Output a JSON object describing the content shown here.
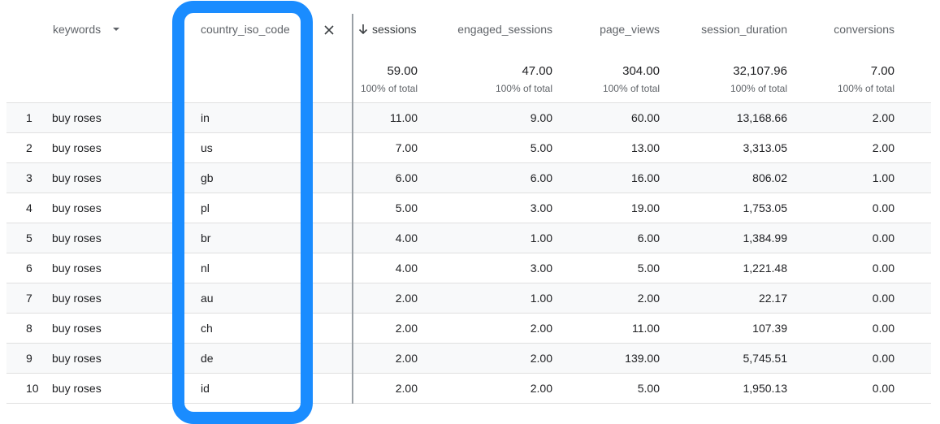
{
  "table": {
    "columns": {
      "keywords": "keywords",
      "country": "country_iso_code",
      "sessions": "sessions",
      "engaged_sessions": "engaged_sessions",
      "page_views": "page_views",
      "session_duration": "session_duration",
      "conversions": "conversions"
    },
    "totals": {
      "sessions": "59.00",
      "engaged_sessions": "47.00",
      "page_views": "304.00",
      "session_duration": "32,107.96",
      "conversions": "7.00"
    },
    "pct_label": "100% of total",
    "rows": [
      {
        "idx": "1",
        "keyword": "buy roses",
        "country": "in",
        "sessions": "11.00",
        "engaged_sessions": "9.00",
        "page_views": "60.00",
        "session_duration": "13,168.66",
        "conversions": "2.00"
      },
      {
        "idx": "2",
        "keyword": "buy roses",
        "country": "us",
        "sessions": "7.00",
        "engaged_sessions": "5.00",
        "page_views": "13.00",
        "session_duration": "3,313.05",
        "conversions": "2.00"
      },
      {
        "idx": "3",
        "keyword": "buy roses",
        "country": "gb",
        "sessions": "6.00",
        "engaged_sessions": "6.00",
        "page_views": "16.00",
        "session_duration": "806.02",
        "conversions": "1.00"
      },
      {
        "idx": "4",
        "keyword": "buy roses",
        "country": "pl",
        "sessions": "5.00",
        "engaged_sessions": "3.00",
        "page_views": "19.00",
        "session_duration": "1,753.05",
        "conversions": "0.00"
      },
      {
        "idx": "5",
        "keyword": "buy roses",
        "country": "br",
        "sessions": "4.00",
        "engaged_sessions": "1.00",
        "page_views": "6.00",
        "session_duration": "1,384.99",
        "conversions": "0.00"
      },
      {
        "idx": "6",
        "keyword": "buy roses",
        "country": "nl",
        "sessions": "4.00",
        "engaged_sessions": "3.00",
        "page_views": "5.00",
        "session_duration": "1,221.48",
        "conversions": "0.00"
      },
      {
        "idx": "7",
        "keyword": "buy roses",
        "country": "au",
        "sessions": "2.00",
        "engaged_sessions": "1.00",
        "page_views": "2.00",
        "session_duration": "22.17",
        "conversions": "0.00"
      },
      {
        "idx": "8",
        "keyword": "buy roses",
        "country": "ch",
        "sessions": "2.00",
        "engaged_sessions": "2.00",
        "page_views": "11.00",
        "session_duration": "107.39",
        "conversions": "0.00"
      },
      {
        "idx": "9",
        "keyword": "buy roses",
        "country": "de",
        "sessions": "2.00",
        "engaged_sessions": "2.00",
        "page_views": "139.00",
        "session_duration": "5,745.51",
        "conversions": "0.00"
      },
      {
        "idx": "10",
        "keyword": "buy roses",
        "country": "id",
        "sessions": "2.00",
        "engaged_sessions": "2.00",
        "page_views": "5.00",
        "session_duration": "1,950.13",
        "conversions": "0.00"
      }
    ]
  },
  "icons": {
    "dropdown": "caret-down-icon",
    "remove": "close-icon",
    "sort": "arrow-down-icon"
  },
  "colors": {
    "highlight": "#1a8cff",
    "divider": "#9aa0a6"
  }
}
